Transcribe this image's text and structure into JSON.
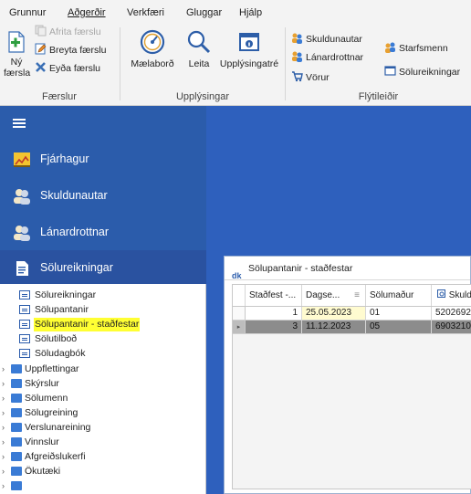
{
  "menu": {
    "tabs": [
      "Grunnur",
      "Aðgerðir",
      "Verkfæri",
      "Gluggar",
      "Hjálp"
    ],
    "active_tab": "Aðgerðir"
  },
  "ribbon": {
    "faerslur": {
      "label": "Færslur",
      "new_label_line1": "Ný",
      "new_label_line2": "færsla",
      "copy_label": "Afrita færslu",
      "edit_label": "Breyta færslu",
      "delete_label": "Eyða færslu"
    },
    "upplysingar": {
      "label": "Upplýsingar",
      "dashboard_label": "Mælaborð",
      "search_label": "Leita",
      "infotree_label": "Upplýsingatré"
    },
    "flytileidir": {
      "label": "Flýtileiðir",
      "debtors_label": "Skuldunautar",
      "creditors_label": "Lánardrottnar",
      "products_label": "Vörur",
      "employees_label": "Starfsmenn",
      "invoices_label": "Sölureikningar"
    }
  },
  "nav": {
    "items": [
      {
        "label": "Fjárhagur",
        "icon": "chart-icon"
      },
      {
        "label": "Skuldunautar",
        "icon": "users-icon"
      },
      {
        "label": "Lánardrottnar",
        "icon": "users-icon"
      },
      {
        "label": "Sölureikningar",
        "icon": "document-icon"
      }
    ]
  },
  "tree": {
    "items": [
      {
        "label": "Sölureikningar",
        "type": "doc"
      },
      {
        "label": "Sölupantanir",
        "type": "doc"
      },
      {
        "label": "Sölupantanir - staðfestar",
        "type": "doc",
        "highlighted": true
      },
      {
        "label": "Sölutilboð",
        "type": "doc"
      },
      {
        "label": "Söludagbók",
        "type": "doc"
      },
      {
        "label": "Uppflettingar",
        "type": "folder"
      },
      {
        "label": "Skýrslur",
        "type": "folder"
      },
      {
        "label": "Sölumenn",
        "type": "folder"
      },
      {
        "label": "Sölugreining",
        "type": "folder"
      },
      {
        "label": "Verslunareining",
        "type": "folder"
      },
      {
        "label": "Vinnslur",
        "type": "folder"
      },
      {
        "label": "Afgreiðslukerfi",
        "type": "folder"
      },
      {
        "label": "Ökutæki",
        "type": "folder"
      }
    ]
  },
  "window": {
    "title": "Sölupantanir - staðfestar",
    "icon_text": "dk",
    "columns": [
      "Staðfest -...",
      "Dagse...",
      "Sölumaður",
      "Skuld"
    ],
    "rows": [
      {
        "stadfest": "1",
        "date": "25.05.2023",
        "salesman": "01",
        "debtor": "5202692"
      },
      {
        "stadfest": "3",
        "date": "11.12.2023",
        "salesman": "05",
        "debtor": "6903210"
      }
    ],
    "selected_row_index": 1
  },
  "colors": {
    "nav_blue": "#2b5cab",
    "workspace_blue": "#2e60bd",
    "highlight_yellow": "#ffff33"
  }
}
